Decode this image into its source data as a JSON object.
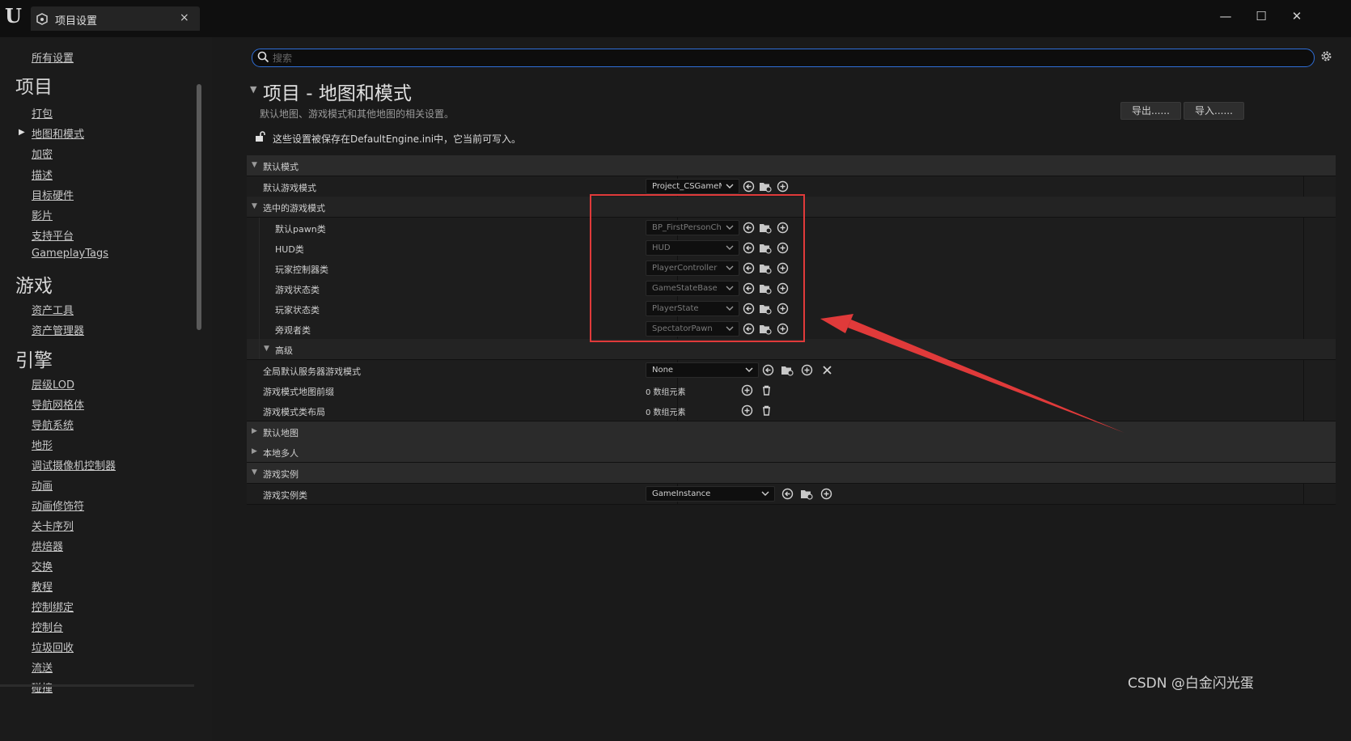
{
  "titlebar": {
    "tab_label": "项目设置",
    "tab_close": "×",
    "minimize": "—",
    "maximize": "☐",
    "close": "✕"
  },
  "sidebar": {
    "all_settings": "所有设置",
    "sections": [
      {
        "title": "项目",
        "items": [
          "打包",
          "地图和模式",
          "加密",
          "描述",
          "目标硬件",
          "影片",
          "支持平台",
          "GameplayTags"
        ]
      },
      {
        "title": "游戏",
        "items": [
          "资产工具",
          "资产管理器"
        ]
      },
      {
        "title": "引擎",
        "items": [
          "层级LOD",
          "导航网格体",
          "导航系统",
          "地形",
          "调试摄像机控制器",
          "动画",
          "动画修饰符",
          "关卡序列",
          "烘焙器",
          "交换",
          "教程",
          "控制绑定",
          "控制台",
          "垃圾回收",
          "流送",
          "碰撞"
        ]
      }
    ],
    "active_item": "地图和模式"
  },
  "search": {
    "placeholder": "搜索",
    "value": ""
  },
  "header": {
    "title": "项目 - 地图和模式",
    "subtitle": "默认地图、游戏模式和其他地图的相关设置。",
    "export_label": "导出......",
    "import_label": "导入......",
    "save_notice": "这些设置被保存在DefaultEngine.ini中，它当前可写入。"
  },
  "details": {
    "default_modes": "默认模式",
    "default_game_mode": {
      "label": "默认游戏模式",
      "value": "Project_CSGameM"
    },
    "selected_game_mode": "选中的游戏模式",
    "selected_rows": [
      {
        "label": "默认pawn类",
        "value": "BP_FirstPersonCh"
      },
      {
        "label": "HUD类",
        "value": "HUD"
      },
      {
        "label": "玩家控制器类",
        "value": "PlayerController"
      },
      {
        "label": "游戏状态类",
        "value": "GameStateBase"
      },
      {
        "label": "玩家状态类",
        "value": "PlayerState"
      },
      {
        "label": "旁观者类",
        "value": "SpectatorPawn"
      }
    ],
    "advanced": "高级",
    "global_server_mode": {
      "label": "全局默认服务器游戏模式",
      "value": "None"
    },
    "game_mode_prefix": {
      "label": "游戏模式地图前缀",
      "value": "0 数组元素"
    },
    "game_mode_class_layout": {
      "label": "游戏模式类布局",
      "value": "0 数组元素"
    },
    "default_maps": "默认地图",
    "local_multiplayer": "本地多人",
    "game_instance": "游戏实例",
    "game_instance_class": {
      "label": "游戏实例类",
      "value": "GameInstance"
    }
  },
  "watermark": "CSDN @白金闪光蛋",
  "colors": {
    "highlight": "#e03a3a",
    "search_border": "#2f6fd8"
  }
}
